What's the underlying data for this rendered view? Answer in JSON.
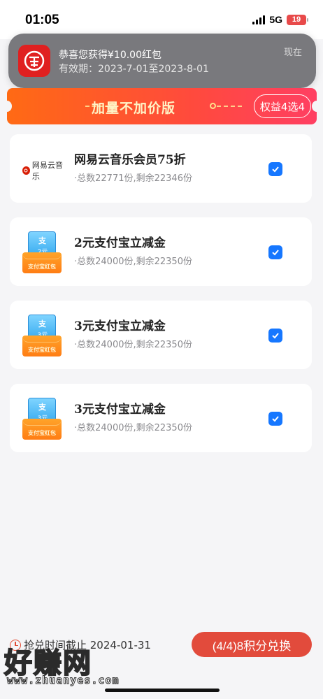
{
  "status_bar": {
    "time": "01:05",
    "network": "5G",
    "battery": "19"
  },
  "notification": {
    "title": "恭喜您获得¥10.00红包",
    "subtitle": "有效期：2023-7-01至2023-8-01",
    "time": "现在",
    "app_icon": "red-envelope-icon"
  },
  "promo": {
    "title": "加量不加价版",
    "badge": "权益4选4",
    "colors": {
      "start": "#ff6a14",
      "end": "#ff3f62",
      "title": "#fff3c6"
    }
  },
  "benefits": [
    {
      "title": "网易云音乐会员75折",
      "subtitle": "·总数22771份,剩余22346份",
      "logo": "netease-music-logo",
      "logo_text": "网易云音乐",
      "checked": true
    },
    {
      "title": "2元支付宝立减金",
      "subtitle": "·总数24000份,剩余22350份",
      "logo": "alipay-red-envelope",
      "logo_value": "2元",
      "logo_text": "支付宝红包",
      "checked": true
    },
    {
      "title": "3元支付宝立减金",
      "subtitle": "·总数24000份,剩余22350份",
      "logo": "alipay-red-envelope",
      "logo_value": "3元",
      "logo_text": "支付宝红包",
      "checked": true
    },
    {
      "title": "3元支付宝立减金",
      "subtitle": "·总数24000份,剩余22350份",
      "logo": "alipay-red-envelope",
      "logo_value": "3元",
      "logo_text": "支付宝红包",
      "checked": true
    }
  ],
  "footer": {
    "deadline": "抢兑时间截止 2024-01-31",
    "redeem_label": "(4/4)8积分兑换",
    "accent": "#e24b3c"
  },
  "watermark": {
    "main": "好赚网",
    "url": "www.zhuanyes.com"
  },
  "accent_color": "#1677ff"
}
